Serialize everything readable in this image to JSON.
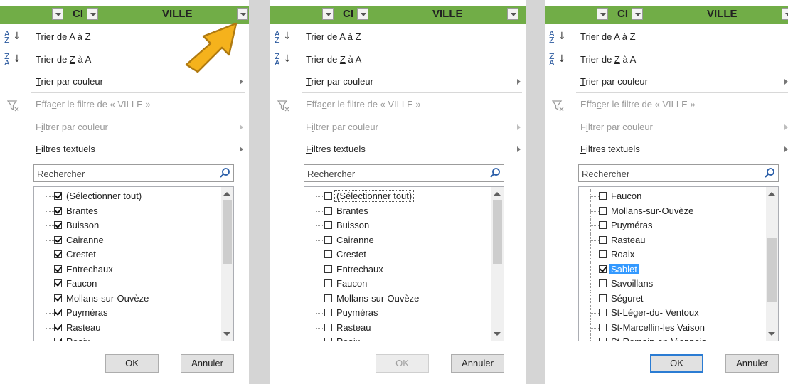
{
  "header": {
    "col_a": "CI",
    "col_b": "VILLE"
  },
  "menu": {
    "sort_az_label": [
      "Trier de ",
      "A",
      " à Z"
    ],
    "sort_za_label": [
      "Trier de ",
      "Z",
      " à A"
    ],
    "sort_color_label": [
      "T",
      "rier par couleur"
    ],
    "clear_filter_label": [
      "Effa",
      "c",
      "er le filtre de « VILLE »"
    ],
    "filter_color_label": [
      "F",
      "i",
      "ltrer par couleur"
    ],
    "text_filters_label": [
      "F",
      "iltres textuels"
    ],
    "icon_a": "A",
    "icon_z": "Z",
    "icon_down": "↓"
  },
  "search": {
    "placeholder": "Rechercher"
  },
  "buttons": {
    "ok": "OK",
    "cancel": "Annuler"
  },
  "panels": [
    {
      "scroll_position": 0.0,
      "ok_enabled": true,
      "ok_default": false,
      "items": [
        {
          "label": "(Sélectionner tout)",
          "checked": true,
          "focus": false,
          "selected": false,
          "first": true
        },
        {
          "label": "Brantes",
          "checked": true
        },
        {
          "label": "Buisson",
          "checked": true
        },
        {
          "label": "Cairanne",
          "checked": true
        },
        {
          "label": "Crestet",
          "checked": true
        },
        {
          "label": "Entrechaux",
          "checked": true
        },
        {
          "label": "Faucon",
          "checked": true
        },
        {
          "label": "Mollans-sur-Ouvèze",
          "checked": true
        },
        {
          "label": "Puyméras",
          "checked": true
        },
        {
          "label": "Rasteau",
          "checked": true
        },
        {
          "label": "Roaix",
          "checked": true
        }
      ]
    },
    {
      "scroll_position": 0.0,
      "ok_enabled": false,
      "ok_default": false,
      "items": [
        {
          "label": "(Sélectionner tout)",
          "checked": false,
          "focus": true,
          "selected": false,
          "first": true
        },
        {
          "label": "Brantes",
          "checked": false
        },
        {
          "label": "Buisson",
          "checked": false
        },
        {
          "label": "Cairanne",
          "checked": false
        },
        {
          "label": "Crestet",
          "checked": false
        },
        {
          "label": "Entrechaux",
          "checked": false
        },
        {
          "label": "Faucon",
          "checked": false
        },
        {
          "label": "Mollans-sur-Ouvèze",
          "checked": false
        },
        {
          "label": "Puyméras",
          "checked": false
        },
        {
          "label": "Rasteau",
          "checked": false
        },
        {
          "label": "Roaix",
          "checked": false
        }
      ]
    },
    {
      "scroll_position": 0.6,
      "ok_enabled": true,
      "ok_default": true,
      "items": [
        {
          "label": "Faucon",
          "checked": false
        },
        {
          "label": "Mollans-sur-Ouvèze",
          "checked": false
        },
        {
          "label": "Puyméras",
          "checked": false
        },
        {
          "label": "Rasteau",
          "checked": false
        },
        {
          "label": "Roaix",
          "checked": false
        },
        {
          "label": "Sablet",
          "checked": true,
          "selected": true
        },
        {
          "label": "Savoillans",
          "checked": false
        },
        {
          "label": "Séguret",
          "checked": false
        },
        {
          "label": "St-Léger-du- Ventoux",
          "checked": false
        },
        {
          "label": "St-Marcellin-les Vaison",
          "checked": false
        },
        {
          "label": "St-Romain-en-Viennois",
          "checked": false
        }
      ]
    }
  ]
}
